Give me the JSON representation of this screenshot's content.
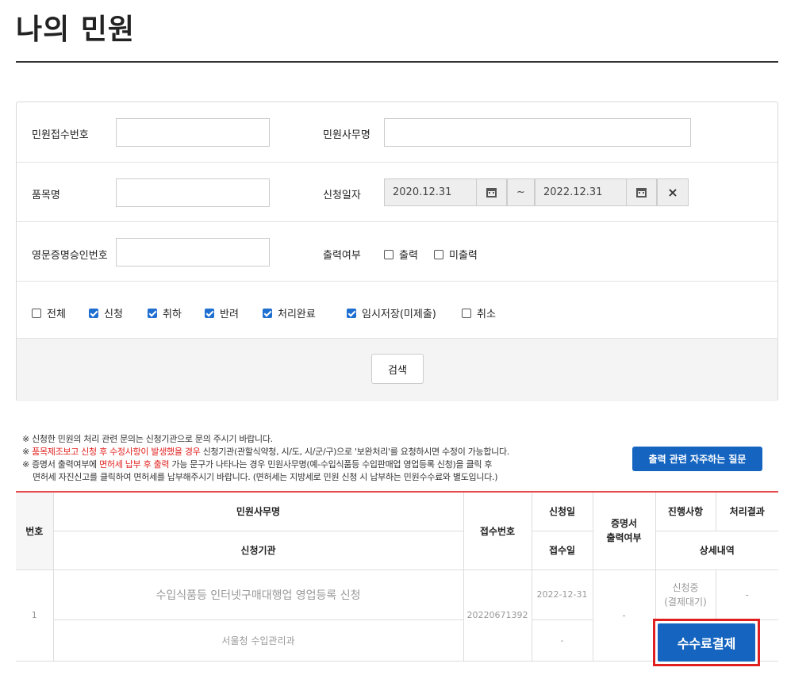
{
  "page": {
    "title": "나의 민원"
  },
  "search": {
    "receipt_no_label": "민원접수번호",
    "receipt_no_value": "",
    "affair_name_label": "민원사무명",
    "affair_name_value": "",
    "item_name_label": "품목명",
    "item_name_value": "",
    "apply_date_label": "신청일자",
    "date_from": "2020.12.31",
    "date_sep": "~",
    "date_to": "2022.12.31",
    "clear_icon": "×",
    "cert_no_label": "영문증명승인번호",
    "cert_no_value": "",
    "print_label": "출력여부",
    "print_options": [
      {
        "label": "출력",
        "checked": false
      },
      {
        "label": "미출력",
        "checked": false
      }
    ],
    "status_options": [
      {
        "label": "전체",
        "checked": false
      },
      {
        "label": "신청",
        "checked": true
      },
      {
        "label": "취하",
        "checked": true
      },
      {
        "label": "반려",
        "checked": true
      },
      {
        "label": "처리완료",
        "checked": true
      },
      {
        "label": "임시저장(미제출)",
        "checked": true
      },
      {
        "label": "취소",
        "checked": false
      }
    ],
    "search_button": "검색"
  },
  "notes": {
    "line1": "※ 신청한 민원의 처리 관련 문의는 신청기관으로 문의 주시기 바랍니다.",
    "line2_prefix": "※ ",
    "line2_red": "품목제조보고 신청 후 수정사항이 발생했을 경우",
    "line2_rest": " 신청기관(관할식약청, 시/도, 시/군/구)으로 '보완처리'를 요청하시면 수정이 가능합니다.",
    "line3_prefix": "※ 증명서 출력여부에 ",
    "line3_red": "면허세 납부 후 출력",
    "line3_rest": " 가능 문구가 나타나는 경우 민원사무명(예-수입식품등 수입판매업 영업등록 신청)을 클릭 후",
    "line4": "면허세 자진신고를 클릭하여 면허세를 납부해주시기 바랍니다. (면허세는 지방세로 민원 신청 시 납부하는 민원수수료와 별도입니다.)",
    "faq_button": "출력 관련 자주하는 질문"
  },
  "table": {
    "headers": {
      "no": "번호",
      "affair_name": "민원사무명",
      "agency": "신청기관",
      "receipt_no": "접수번호",
      "apply_date": "신청일",
      "receive_date": "접수일",
      "cert_print": "증명서\n출력여부",
      "progress": "진행사항",
      "result": "처리결과",
      "detail": "상세내역"
    },
    "rows": [
      {
        "no": "1",
        "affair_name": "수입식품등 인터넷구매대행업 영업등록 신청",
        "agency": "서울청 수입관리과",
        "receipt_no": "20220671392",
        "apply_date": "2022-12-31",
        "receive_date": "-",
        "cert_print": "-",
        "progress": "신청중\n(결제대기)",
        "result": "-",
        "pay_button": "수수료결제"
      }
    ]
  }
}
